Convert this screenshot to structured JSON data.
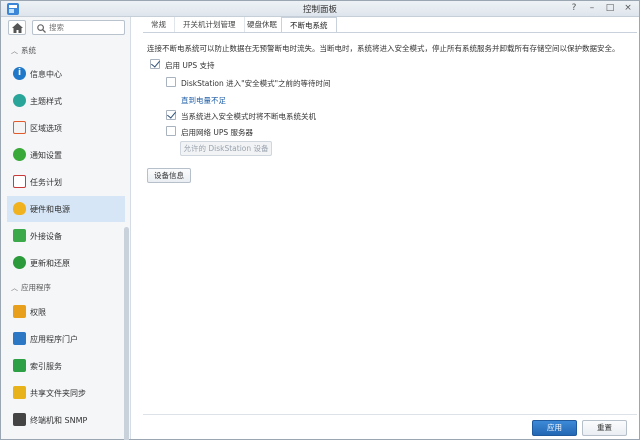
{
  "window": {
    "title": "控制面板"
  },
  "sidebar": {
    "search_placeholder": "搜索",
    "groups": [
      {
        "label": "系统"
      },
      {
        "label": "应用程序"
      }
    ],
    "items": [
      {
        "label": "信息中心",
        "icon": "info-icon"
      },
      {
        "label": "主题样式",
        "icon": "palette-icon"
      },
      {
        "label": "区域选项",
        "icon": "calendar-region-icon"
      },
      {
        "label": "通知设置",
        "icon": "chat-bubble-icon"
      },
      {
        "label": "任务计划",
        "icon": "calendar-check-icon"
      },
      {
        "label": "硬件和电源",
        "icon": "lightbulb-icon",
        "active": true
      },
      {
        "label": "外接设备",
        "icon": "upload-device-icon"
      },
      {
        "label": "更新和还原",
        "icon": "refresh-icon"
      },
      {
        "label": "权限",
        "icon": "grid-permission-icon"
      },
      {
        "label": "应用程序门户",
        "icon": "portal-icon"
      },
      {
        "label": "索引服务",
        "icon": "search-index-icon"
      },
      {
        "label": "共享文件夹同步",
        "icon": "folder-sync-icon"
      },
      {
        "label": "终端机和 SNMP",
        "icon": "terminal-icon"
      }
    ]
  },
  "tabs": [
    {
      "label": "常规"
    },
    {
      "label": "开关机计划管理"
    },
    {
      "label": "硬盘休眠"
    },
    {
      "label": "不断电系统",
      "active": true
    }
  ],
  "content": {
    "description": "连接不断电系统可以防止数据在无预警断电时流失。当断电时，系统将进入安全模式，停止所有系统服务并卸载所有存储空间以保护数据安全。",
    "enable_ups": {
      "label": "启用 UPS 支持",
      "checked": true
    },
    "wait_time": {
      "label": "DiskStation 进入\"安全模式\"之前的等待时间",
      "checked": false
    },
    "wait_value": "直到电量不足",
    "shutdown_ups": {
      "label": "当系统进入安全模式时将不断电系统关机",
      "checked": true
    },
    "network_ups": {
      "label": "启用网络 UPS 服务器",
      "checked": false
    },
    "allowed_button": "允许的 DiskStation 设备",
    "device_info_button": "设备信息"
  },
  "footer": {
    "apply": "应用",
    "reset": "重置"
  }
}
